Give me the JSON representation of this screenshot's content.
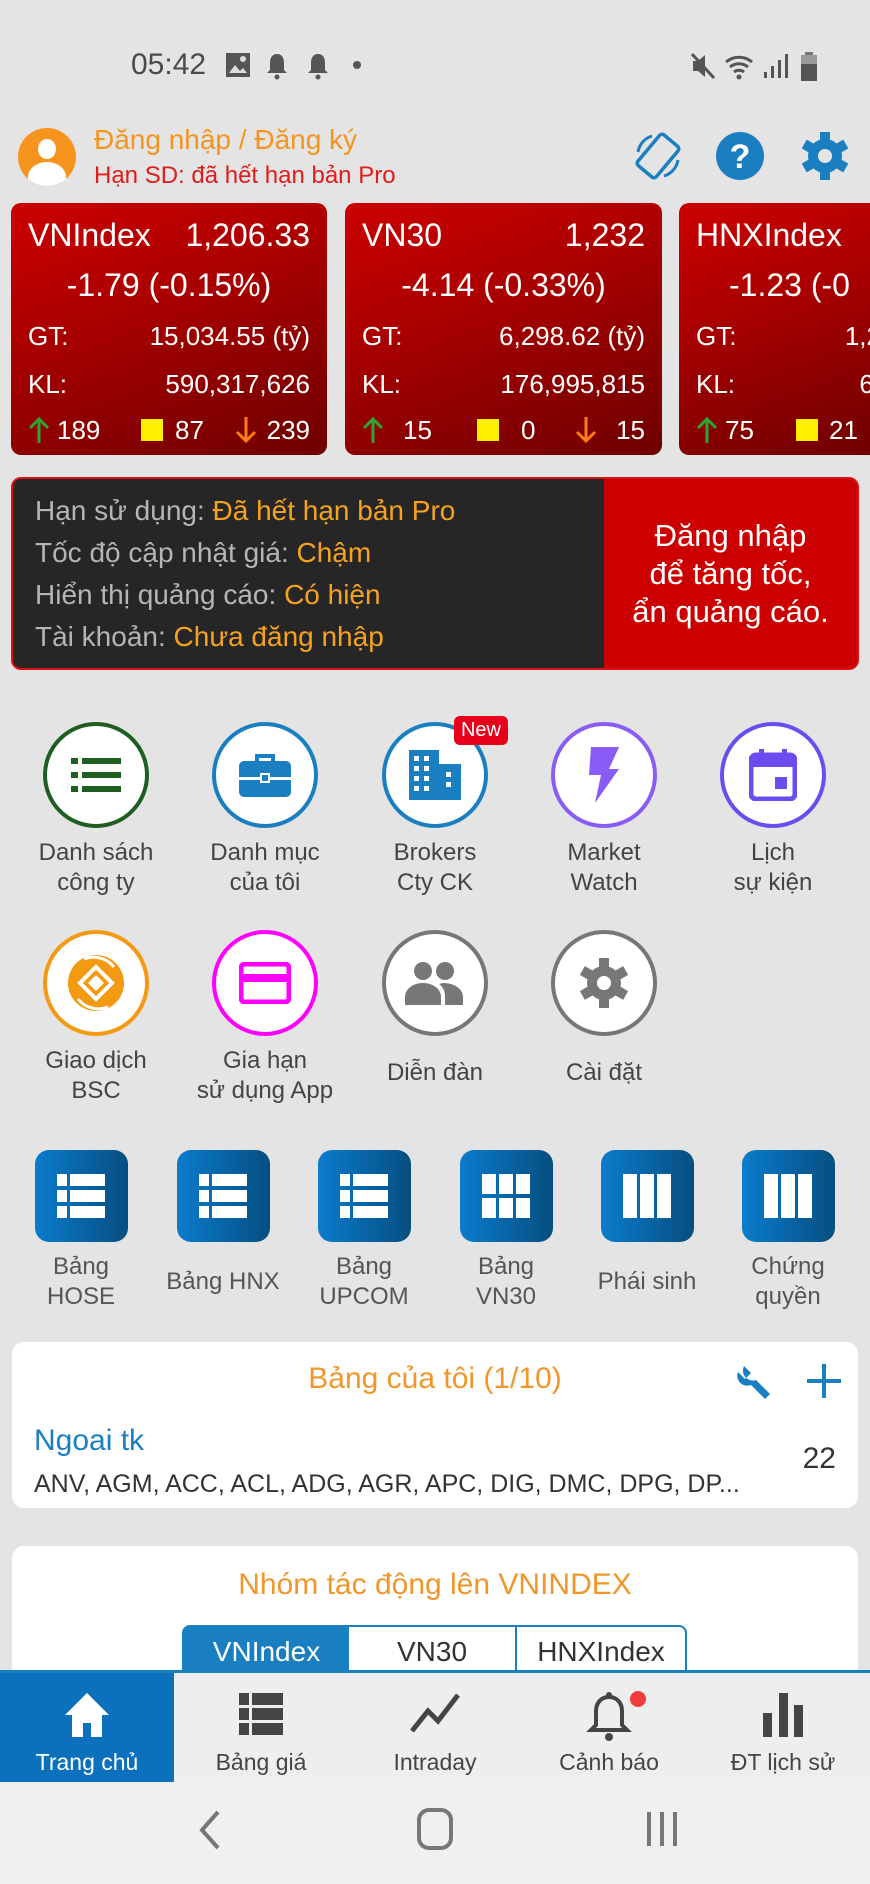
{
  "status_bar": {
    "time": "05:42",
    "left_icons": [
      "image-icon",
      "bell-icon",
      "bell-icon",
      "dot-icon"
    ],
    "right_icons": [
      "mute-icon",
      "wifi-icon",
      "signal-icon",
      "battery-icon"
    ]
  },
  "header": {
    "login_label": "Đăng nhập / Đăng ký",
    "subscription": "Hạn SD: đã hết hạn bản Pro",
    "icons": [
      "rotate-icon",
      "help-icon",
      "settings-icon"
    ]
  },
  "indices": [
    {
      "name": "VNIndex",
      "price": "1,206.33",
      "change": "-1.79 (-0.15%)",
      "gt_label": "GT:",
      "gt": "15,034.55 (tỷ)",
      "kl_label": "KL:",
      "kl": "590,317,626",
      "up": "189",
      "flat": "87",
      "down": "239"
    },
    {
      "name": "VN30",
      "price": "1,232",
      "change": "-4.14 (-0.33%)",
      "gt_label": "GT:",
      "gt": "6,298.62 (tỷ)",
      "kl_label": "KL:",
      "kl": "176,995,815",
      "up": "15",
      "flat": "0",
      "down": "15"
    },
    {
      "name": "HNXIndex",
      "price": "",
      "change": "-1.23 (-0",
      "gt_label": "GT:",
      "gt": "1,2",
      "kl_label": "KL:",
      "kl": "6:",
      "up": "75",
      "flat": "21",
      "down": ""
    }
  ],
  "info": {
    "rows": [
      {
        "label": "Hạn sử dụng: ",
        "value": "Đã hết hạn bản Pro"
      },
      {
        "label": "Tốc độ cập nhật giá: ",
        "value": "Chậm"
      },
      {
        "label": "Hiển thị quảng cáo: ",
        "value": "Có hiện"
      },
      {
        "label": "Tài khoản: ",
        "value": "Chưa đăng nhập"
      }
    ],
    "cta": [
      "Đăng nhập",
      "để tăng tốc,",
      "ẩn quảng cáo."
    ]
  },
  "features": [
    {
      "line1": "Danh sách",
      "line2": "công ty",
      "color": "#1e5e20"
    },
    {
      "line1": "Danh mục",
      "line2": "của tôi",
      "color": "#1a7fc1"
    },
    {
      "line1": "Brokers",
      "line2": "Cty CK",
      "color": "#1a7fc1",
      "badge": "New"
    },
    {
      "line1": "Market",
      "line2": "Watch",
      "color": "#8a5cf6"
    },
    {
      "line1": "Lịch",
      "line2": "sự kiện",
      "color": "#6a4cf0"
    },
    {
      "line1": "Giao dịch",
      "line2": "BSC",
      "color": "#f39a12"
    },
    {
      "line1": "Gia hạn",
      "line2": "sử dụng App",
      "color": "#ff00ff"
    },
    {
      "line1": "Diễn đàn",
      "line2": "",
      "color": "#777777"
    },
    {
      "line1": "Cài đặt",
      "line2": "",
      "color": "#777777"
    }
  ],
  "boards": [
    {
      "line1": "Bảng",
      "line2": "HOSE"
    },
    {
      "line1": "Bảng HNX",
      "line2": ""
    },
    {
      "line1": "Bảng",
      "line2": "UPCOM"
    },
    {
      "line1": "Bảng",
      "line2": "VN30"
    },
    {
      "line1": "Phái sinh",
      "line2": ""
    },
    {
      "line1": "Chứng",
      "line2": "quyền"
    }
  ],
  "my_board": {
    "title": "Bảng của tôi (1/10)",
    "name": "Ngoai tk",
    "symbols": "ANV, AGM, ACC, ACL, ADG, AGR, APC, DIG, DMC, DPG, DP...",
    "count": "22"
  },
  "impact": {
    "title": "Nhóm tác động lên VNINDEX",
    "tabs": [
      "VNIndex",
      "VN30",
      "HNXIndex"
    ],
    "active_tab": "VNIndex"
  },
  "bottom_nav": [
    {
      "label": "Trang chủ",
      "active": true
    },
    {
      "label": "Bảng giá"
    },
    {
      "label": "Intraday"
    },
    {
      "label": "Cảnh báo",
      "dot": true
    },
    {
      "label": "ĐT lịch sử"
    }
  ],
  "colors": {
    "accent": "#1a7fc1",
    "orange": "#f7941d",
    "red": "#cc0000"
  }
}
